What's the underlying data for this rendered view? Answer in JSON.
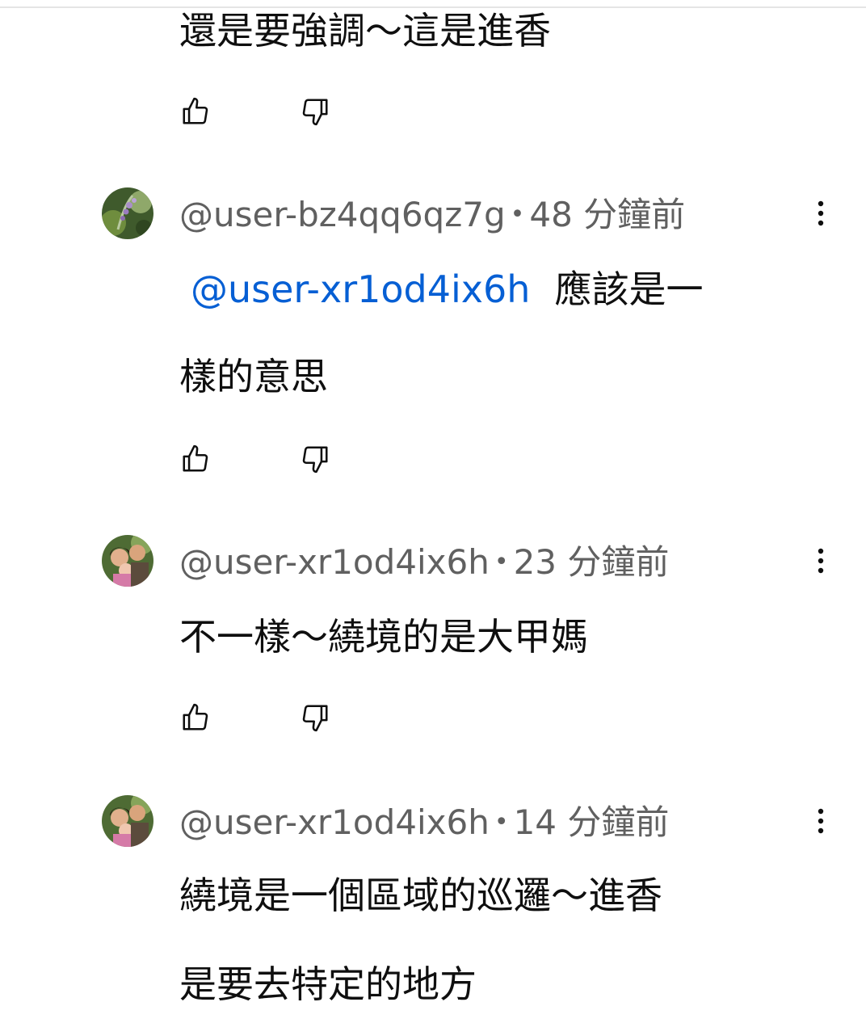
{
  "comments": [
    {
      "text_lines": [
        "還是要強調～這是進香"
      ]
    },
    {
      "handle": "@user-bz4qq6qz7g",
      "separator": "•",
      "time": "48 分鐘前",
      "mention": "@user-xr1od4ix6h",
      "text_line1_rest": "應該是一",
      "text_line2": "樣的意思"
    },
    {
      "handle": "@user-xr1od4ix6h",
      "separator": "•",
      "time": "23 分鐘前",
      "text_line1": "不一樣～繞境的是大甲媽"
    },
    {
      "handle": "@user-xr1od4ix6h",
      "separator": "•",
      "time": "14 分鐘前",
      "text_line1": "繞境是一個區域的巡邏～進香",
      "text_line2": "是要去特定的地方"
    }
  ],
  "icons": {
    "like": "thumb-up-icon",
    "dislike": "thumb-down-icon",
    "menu": "more-vert-icon"
  },
  "colors": {
    "mention": "#065fd4",
    "meta": "#606060",
    "text": "#0f0f0f"
  }
}
